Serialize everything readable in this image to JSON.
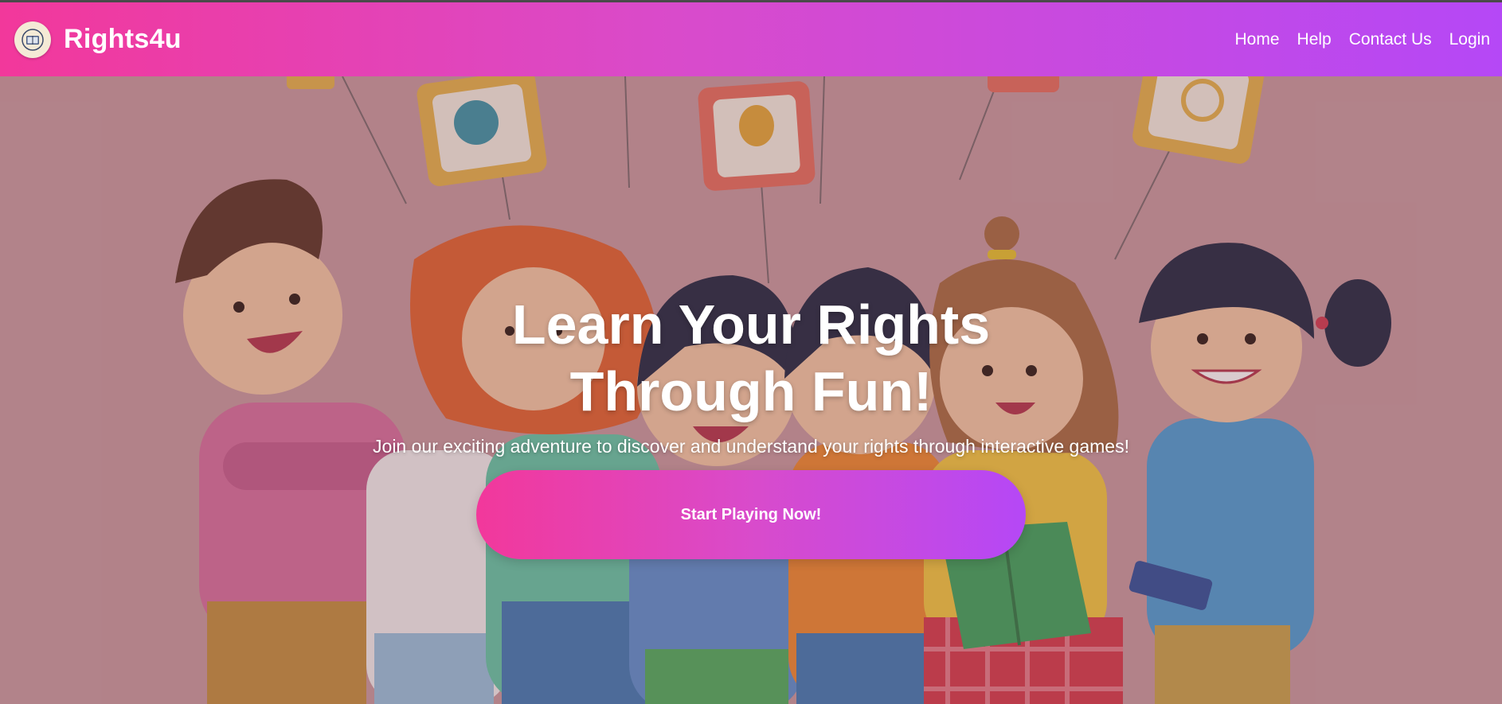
{
  "navbar": {
    "brand_name": "Rights4u",
    "logo_icon": "book-emblem-icon",
    "links": [
      {
        "label": "Home"
      },
      {
        "label": "Help"
      },
      {
        "label": "Contact Us"
      },
      {
        "label": "Login"
      }
    ],
    "gradient": [
      "#f2389b",
      "#d94bcb",
      "#b548f6"
    ]
  },
  "hero": {
    "title": "Learn Your Rights Through Fun!",
    "subtitle": "Join our exciting adventure to discover and understand your rights through interactive games!",
    "cta_label": "Start Playing Now!",
    "background_image": "children-reading-illustration"
  }
}
